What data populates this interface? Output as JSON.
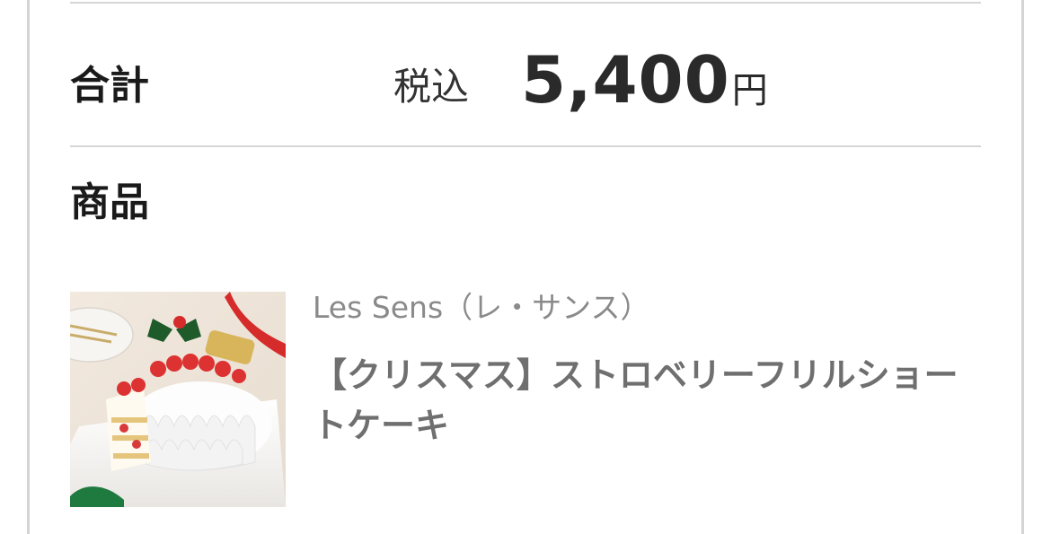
{
  "order_summary": {
    "total_label": "合計",
    "tax_label": "税込",
    "total_amount": "5,400",
    "currency_unit": "円"
  },
  "products": {
    "section_title": "商品",
    "items": [
      {
        "shop_name": "Les Sens（レ・サンス）",
        "product_name": "【クリスマス】ストロベリーフリルショートケーキ",
        "image_icon": "christmas-strawberry-cake-photo"
      }
    ]
  },
  "colors": {
    "primary_text": "#1a1a1a",
    "secondary_text": "#8a8a8a",
    "product_name_text": "#6f6f6f",
    "divider": "#d6d6d6"
  }
}
